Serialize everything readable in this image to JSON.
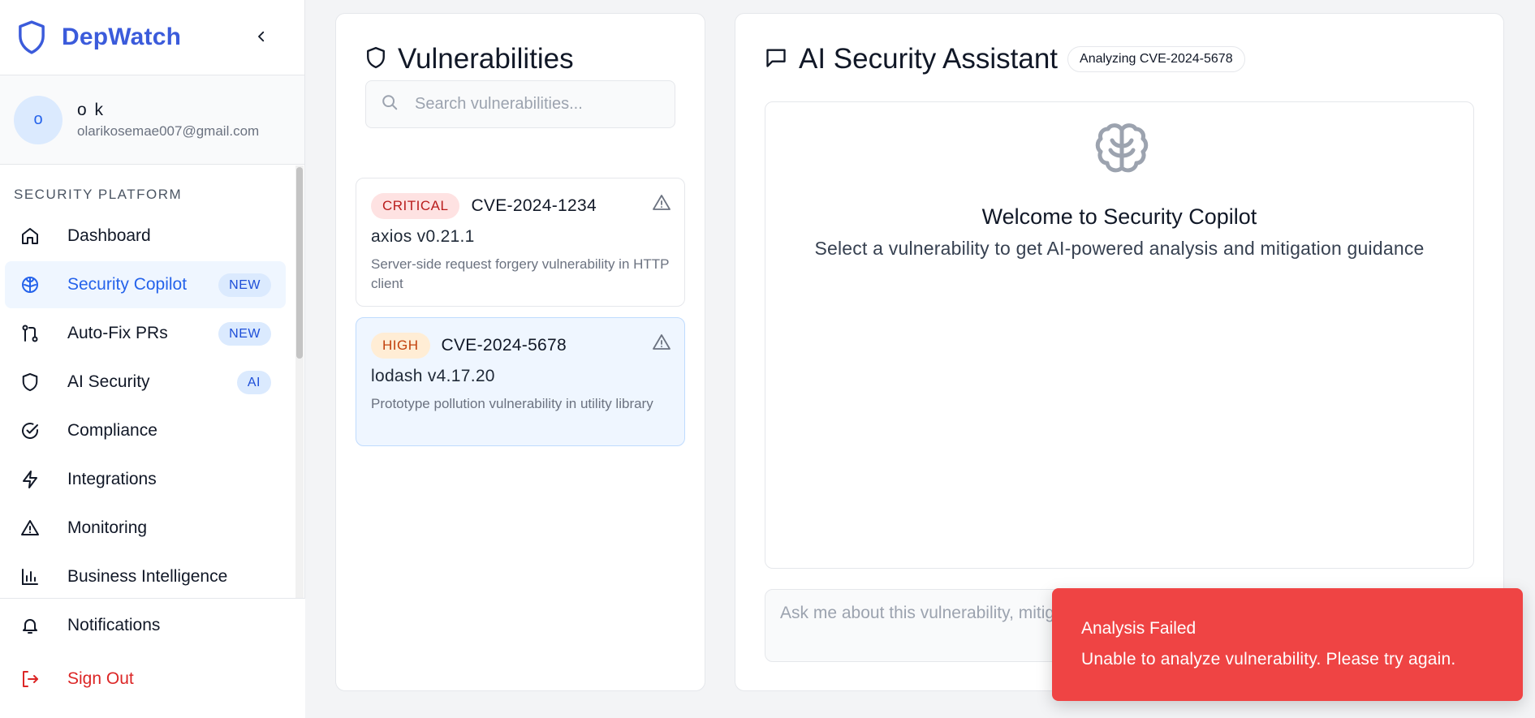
{
  "app": {
    "name": "DepWatch",
    "brand_color": "#3b5bdb"
  },
  "user": {
    "initial": "o",
    "name": "o k",
    "email": "olarikosemae007@gmail.com"
  },
  "sidebar": {
    "section_title": "SECURITY PLATFORM",
    "items": [
      {
        "label": "Dashboard",
        "icon": "home-icon",
        "active": false
      },
      {
        "label": "Security Copilot",
        "icon": "brain-icon",
        "active": true,
        "badge": "NEW"
      },
      {
        "label": "Auto-Fix PRs",
        "icon": "git-pull-request-icon",
        "active": false,
        "badge": "NEW"
      },
      {
        "label": "AI Security",
        "icon": "shield-icon",
        "active": false,
        "badge": "AI"
      },
      {
        "label": "Compliance",
        "icon": "check-circle-icon",
        "active": false
      },
      {
        "label": "Integrations",
        "icon": "lightning-icon",
        "active": false
      },
      {
        "label": "Monitoring",
        "icon": "alert-triangle-icon",
        "active": false
      },
      {
        "label": "Business Intelligence",
        "icon": "bar-chart-icon",
        "active": false
      }
    ],
    "bottom": {
      "notifications": "Notifications",
      "sign_out": "Sign Out"
    }
  },
  "vulnerabilities": {
    "title": "Vulnerabilities",
    "search_placeholder": "Search vulnerabilities...",
    "items": [
      {
        "severity": "CRITICAL",
        "cve": "CVE-2024-1234",
        "package": "axios v0.21.1",
        "description": "Server-side request forgery vulnerability in HTTP client",
        "selected": false
      },
      {
        "severity": "HIGH",
        "cve": "CVE-2024-5678",
        "package": "lodash v4.17.20",
        "description": "Prototype pollution vulnerability in utility library",
        "selected": true
      }
    ]
  },
  "assistant": {
    "title": "AI Security Assistant",
    "status_chip": "Analyzing CVE-2024-5678",
    "welcome_title": "Welcome to Security Copilot",
    "welcome_subtitle": "Select a vulnerability to get AI-powered analysis and mitigation guidance",
    "input_placeholder": "Ask me about this vulnerability, mitigation strategies, or security best practices..."
  },
  "toast": {
    "title": "Analysis Failed",
    "message": "Unable to analyze vulnerability. Please try again.",
    "color": "#ef4444"
  }
}
